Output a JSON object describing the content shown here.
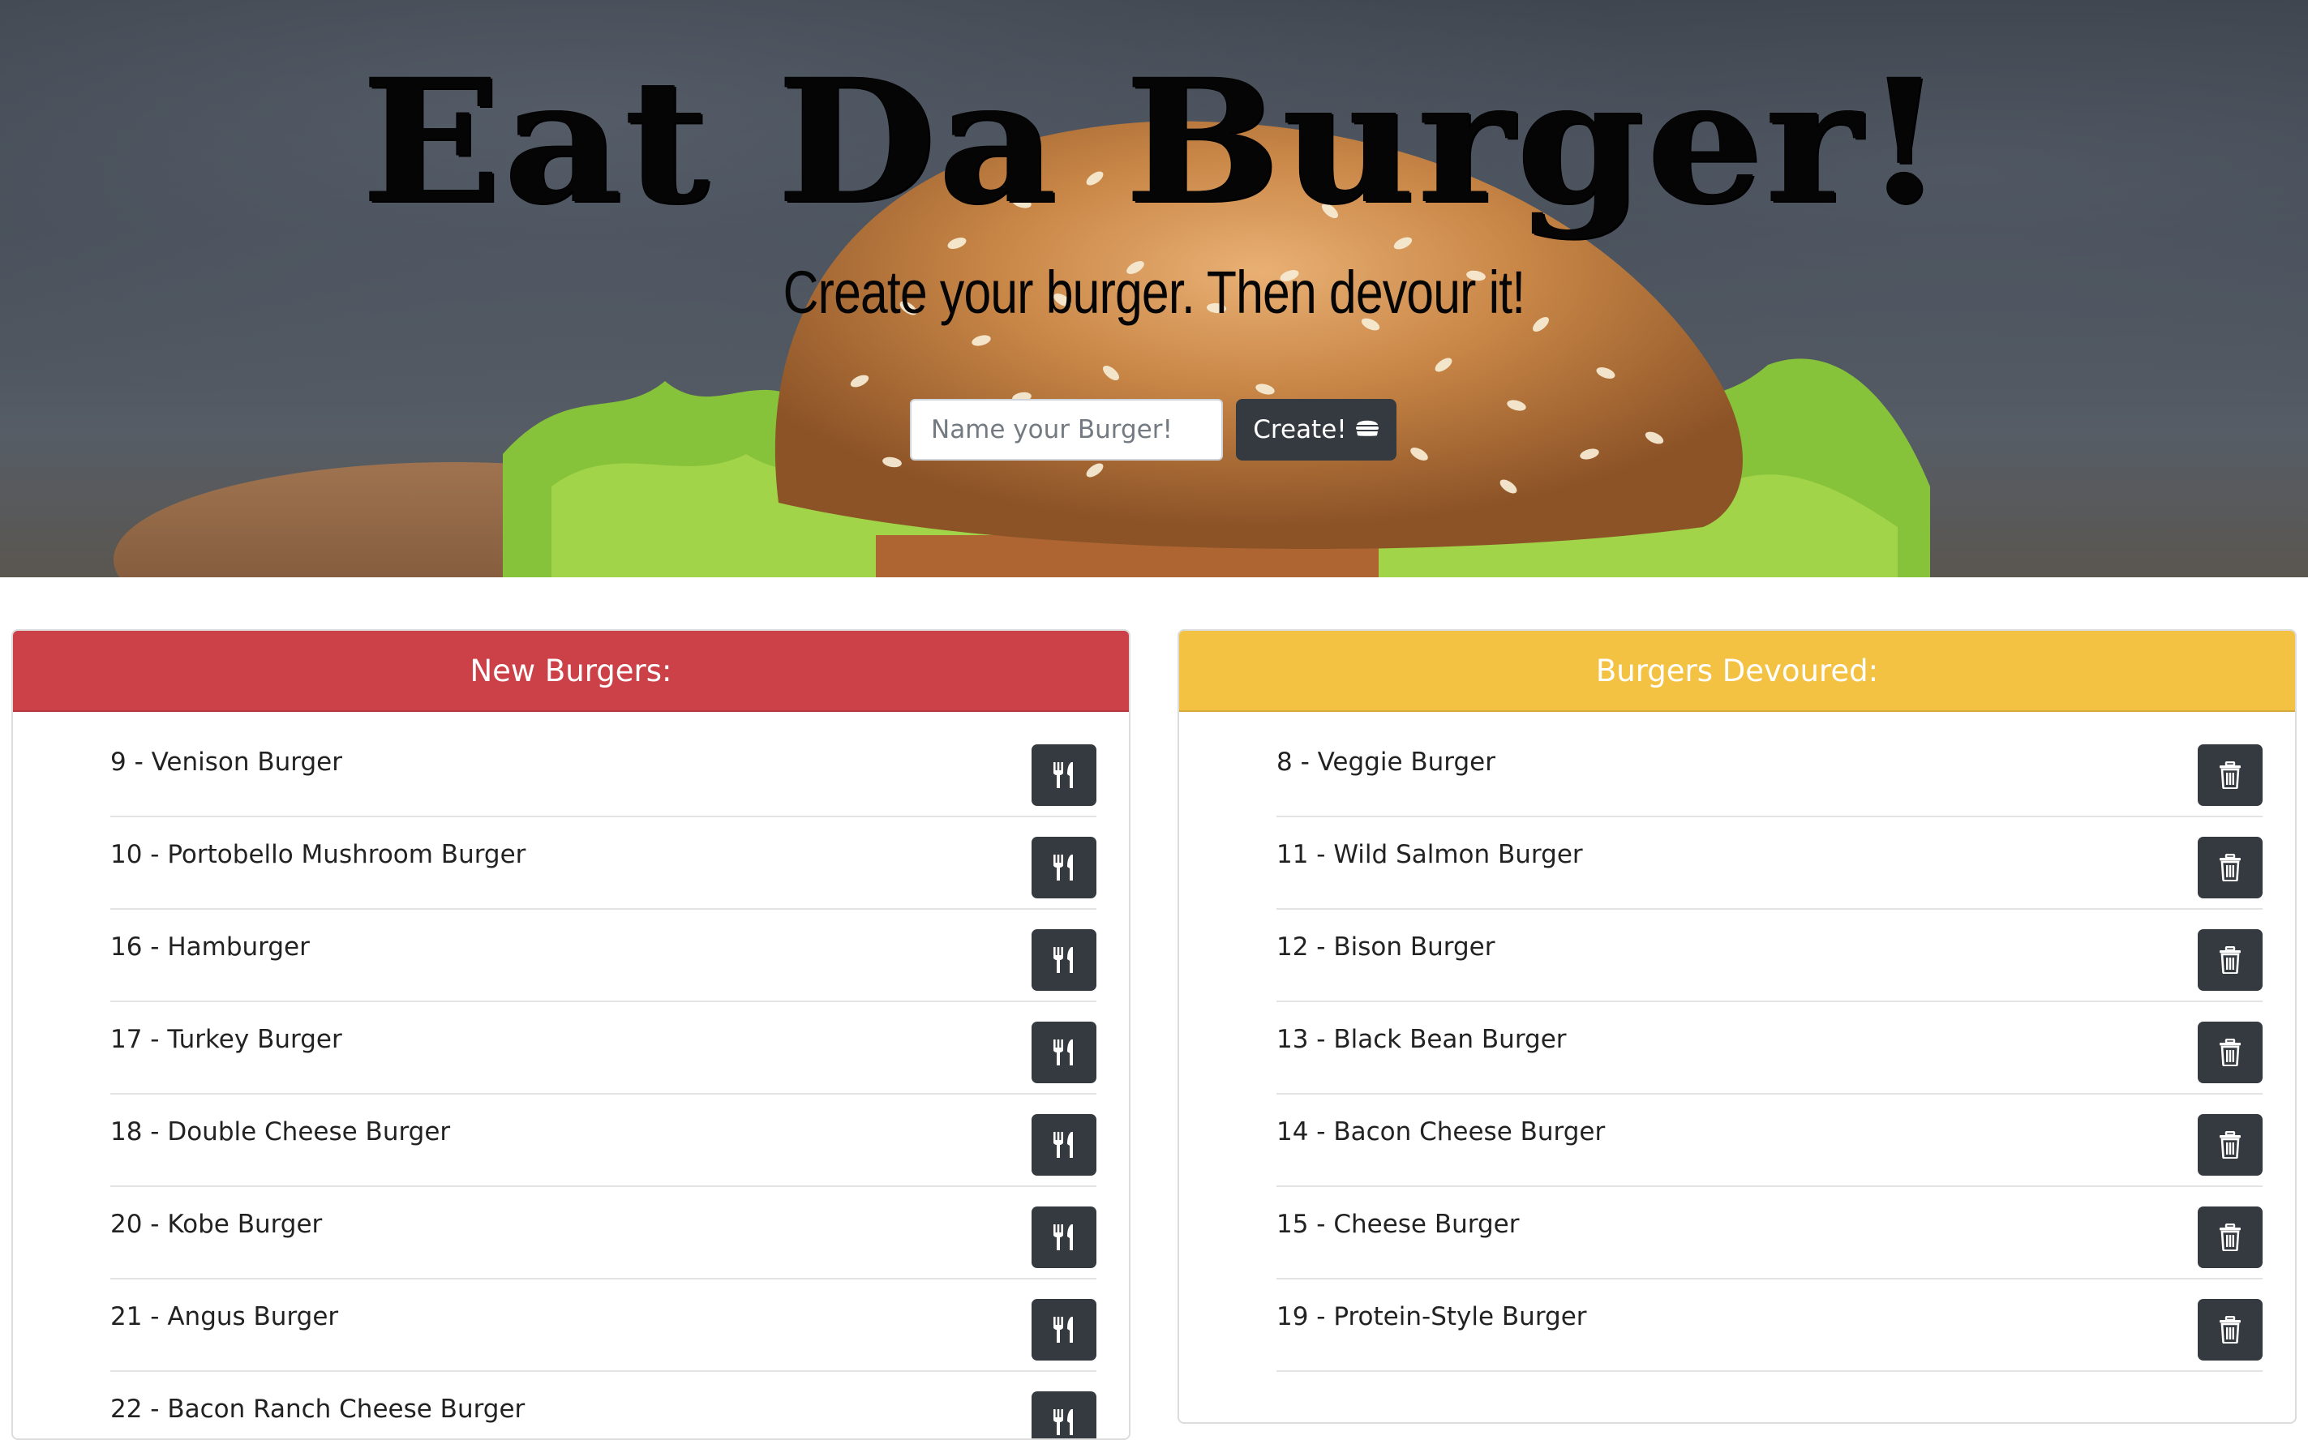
{
  "hero": {
    "title": "Eat Da Burger!",
    "subtitle": "Create your burger. Then devour it!",
    "input_placeholder": "Name your Burger!",
    "create_label": "Create!",
    "create_icon": "hamburger-icon"
  },
  "new_burgers": {
    "header": "New Burgers:",
    "header_color": "#cc4148",
    "action_icon": "utensils-icon",
    "items": [
      {
        "label": "9 - Venison Burger"
      },
      {
        "label": "10 - Portobello Mushroom Burger"
      },
      {
        "label": "16 - Hamburger"
      },
      {
        "label": "17 - Turkey Burger"
      },
      {
        "label": "18 - Double Cheese Burger"
      },
      {
        "label": "20 - Kobe Burger"
      },
      {
        "label": "21 - Angus Burger"
      },
      {
        "label": "22 - Bacon Ranch Cheese Burger"
      }
    ]
  },
  "devoured_burgers": {
    "header": "Burgers Devoured:",
    "header_color": "#f4c242",
    "action_icon": "trash-icon",
    "items": [
      {
        "label": "8 - Veggie Burger"
      },
      {
        "label": "11 - Wild Salmon Burger"
      },
      {
        "label": "12 - Bison Burger"
      },
      {
        "label": "13 - Black Bean Burger"
      },
      {
        "label": "14 - Bacon Cheese Burger"
      },
      {
        "label": "15 - Cheese Burger"
      },
      {
        "label": "19 - Protein-Style Burger"
      }
    ]
  },
  "colors": {
    "button_dark": "#343a40"
  }
}
